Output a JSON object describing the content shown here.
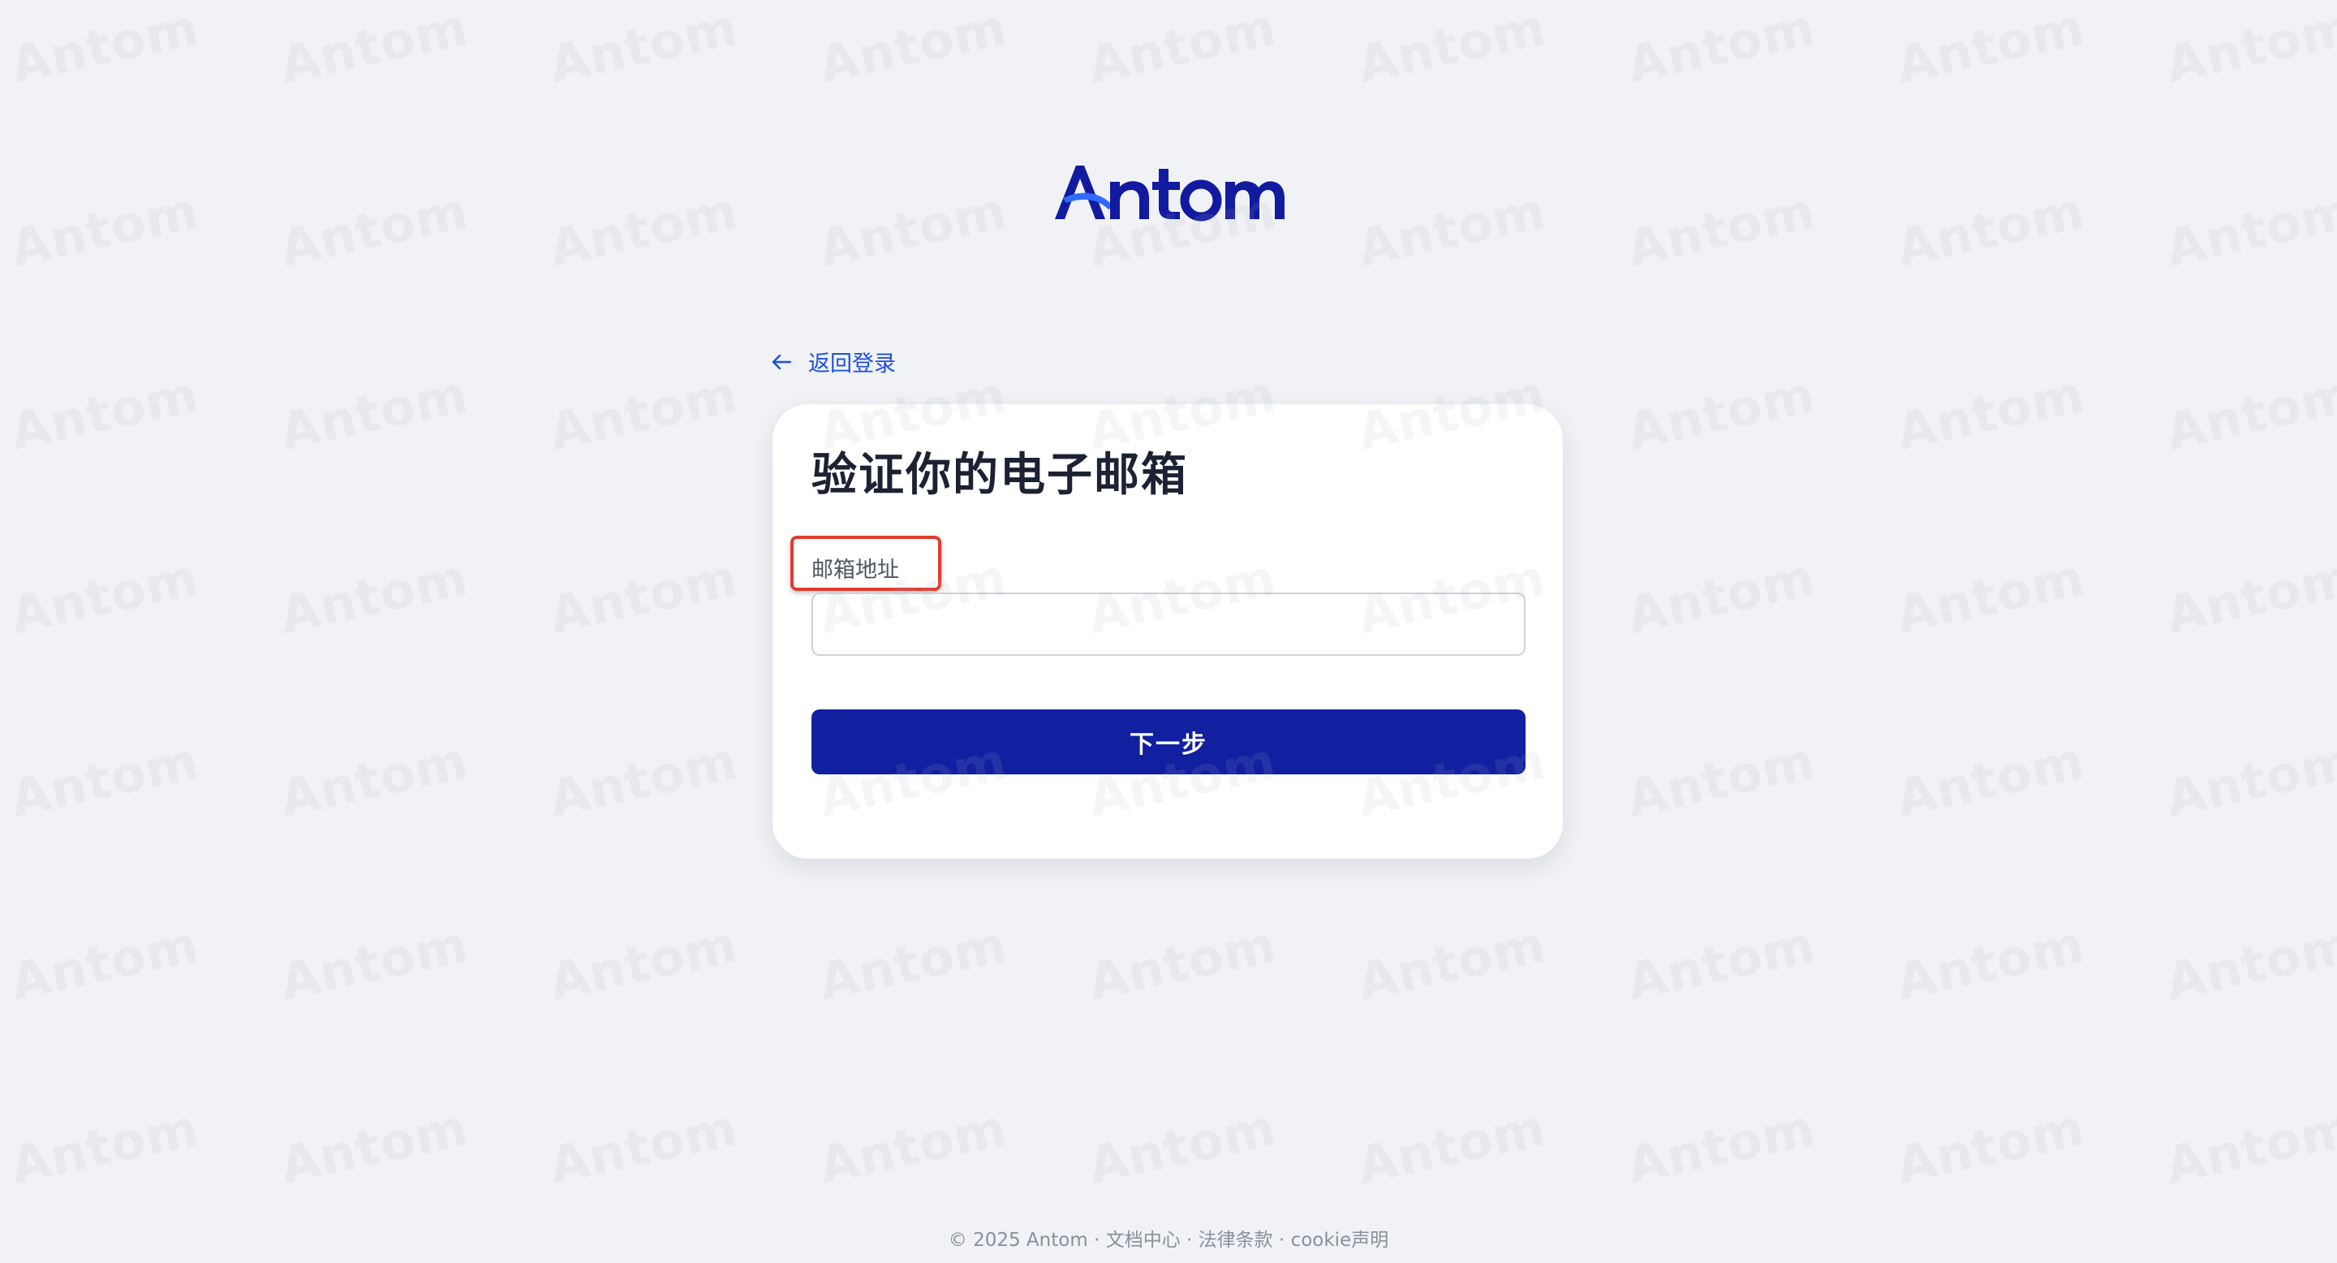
{
  "brand": {
    "logo_text": "Antom",
    "primary_color": "#111fa1",
    "link_color": "#1e4fe0",
    "watermark_text": "Antom"
  },
  "nav": {
    "back_icon": "arrow-left-icon",
    "back_label": "返回登录"
  },
  "form": {
    "title": "验证你的电子邮箱",
    "email_label": "邮箱地址",
    "email_value": "",
    "email_placeholder": "",
    "next_label": "下一步"
  },
  "annotation": {
    "color": "#e33b2d"
  },
  "footer": {
    "copyright": "© 2025 Antom",
    "separator": " · ",
    "links": [
      "文档中心",
      "法律条款",
      "cookie声明"
    ]
  }
}
